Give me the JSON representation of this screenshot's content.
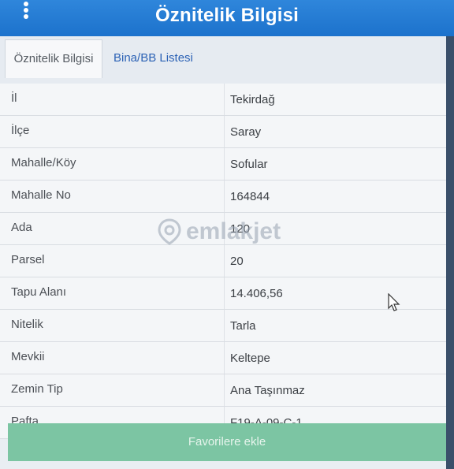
{
  "header": {
    "title": "Öznitelik Bilgisi",
    "menu_icon": "more-vertical-icon"
  },
  "tabs": [
    {
      "label": "Öznitelik Bilgisi",
      "active": true
    },
    {
      "label": "Bina/BB Listesi",
      "active": false
    }
  ],
  "attributes": [
    {
      "label": "İl",
      "value": "Tekirdağ"
    },
    {
      "label": "İlçe",
      "value": "Saray"
    },
    {
      "label": "Mahalle/Köy",
      "value": "Sofular"
    },
    {
      "label": "Mahalle No",
      "value": "164844"
    },
    {
      "label": "Ada",
      "value": "120"
    },
    {
      "label": "Parsel",
      "value": "20"
    },
    {
      "label": "Tapu Alanı",
      "value": "14.406,56"
    },
    {
      "label": "Nitelik",
      "value": "Tarla"
    },
    {
      "label": "Mevkii",
      "value": "Keltepe"
    },
    {
      "label": "Zemin Tip",
      "value": "Ana Taşınmaz"
    },
    {
      "label": "Pafta",
      "value": "F19-A-09-C-1"
    }
  ],
  "actions": {
    "favorites_label": "Favorilere ekle"
  },
  "watermark": {
    "text": "emlakjet"
  },
  "colors": {
    "header_blue": "#1c72cc",
    "tab_link_blue": "#2c62b5",
    "favorites_green": "#7cc5a3"
  }
}
